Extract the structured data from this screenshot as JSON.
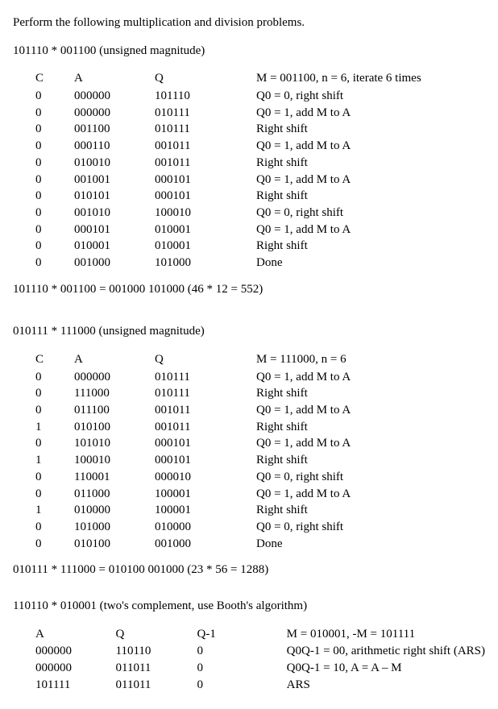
{
  "intro": "Perform the following multiplication and division problems.",
  "p1": {
    "title": "101110 * 001100 (unsigned magnitude)",
    "headers": {
      "c": "C",
      "a": "A",
      "q": "Q",
      "cmt": "M = 001100, n = 6, iterate 6 times"
    },
    "rows": [
      {
        "c": "0",
        "a": "000000",
        "q": "101110",
        "cmt": "Q0 = 0, right shift"
      },
      {
        "c": "0",
        "a": "000000",
        "q": "010111",
        "cmt": "Q0 = 1, add M to A"
      },
      {
        "c": "0",
        "a": "001100",
        "q": "010111",
        "cmt": "Right shift"
      },
      {
        "c": "0",
        "a": "000110",
        "q": "001011",
        "cmt": "Q0 = 1, add M to A"
      },
      {
        "c": "0",
        "a": "010010",
        "q": "001011",
        "cmt": "Right shift"
      },
      {
        "c": "0",
        "a": "001001",
        "q": "000101",
        "cmt": "Q0 = 1, add M to A"
      },
      {
        "c": "0",
        "a": "010101",
        "q": "000101",
        "cmt": "Right shift"
      },
      {
        "c": "0",
        "a": "001010",
        "q": "100010",
        "cmt": "Q0 = 0, right shift"
      },
      {
        "c": "0",
        "a": "000101",
        "q": "010001",
        "cmt": "Q0 = 1, add M to A"
      },
      {
        "c": "0",
        "a": "010001",
        "q": "010001",
        "cmt": "Right shift"
      },
      {
        "c": "0",
        "a": "001000",
        "q": "101000",
        "cmt": "Done"
      }
    ],
    "result": "101110 * 001100 = 001000 101000 (46 * 12 = 552)"
  },
  "p2": {
    "title": "010111 * 111000 (unsigned magnitude)",
    "headers": {
      "c": "C",
      "a": "A",
      "q": "Q",
      "cmt": "M = 111000, n = 6"
    },
    "rows": [
      {
        "c": "0",
        "a": "000000",
        "q": "010111",
        "cmt": "Q0 = 1, add M to A"
      },
      {
        "c": "0",
        "a": "111000",
        "q": "010111",
        "cmt": "Right shift"
      },
      {
        "c": "0",
        "a": "011100",
        "q": "001011",
        "cmt": "Q0 = 1, add M to A"
      },
      {
        "c": "1",
        "a": "010100",
        "q": "001011",
        "cmt": "Right shift"
      },
      {
        "c": "0",
        "a": "101010",
        "q": "000101",
        "cmt": "Q0 = 1, add M to A"
      },
      {
        "c": "1",
        "a": "100010",
        "q": "000101",
        "cmt": "Right shift"
      },
      {
        "c": "0",
        "a": "110001",
        "q": "000010",
        "cmt": "Q0 = 0, right shift"
      },
      {
        "c": "0",
        "a": "011000",
        "q": "100001",
        "cmt": "Q0 = 1, add M to A"
      },
      {
        "c": "1",
        "a": "010000",
        "q": "100001",
        "cmt": "Right shift"
      },
      {
        "c": "0",
        "a": "101000",
        "q": "010000",
        "cmt": "Q0 = 0, right shift"
      },
      {
        "c": "0",
        "a": "010100",
        "q": "001000",
        "cmt": "Done"
      }
    ],
    "result": "010111 * 111000 = 010100 001000 (23 * 56 = 1288)"
  },
  "p3": {
    "title": "110110 * 010001 (two's complement, use Booth's algorithm)",
    "headers": {
      "a": "A",
      "q": "Q",
      "q1": "Q-1",
      "cmt": "M = 010001, -M = 101111"
    },
    "rows": [
      {
        "a": "000000",
        "q": "110110",
        "q1": "0",
        "cmt": "Q0Q-1 = 00, arithmetic right shift (ARS)"
      },
      {
        "a": "000000",
        "q": "011011",
        "q1": "0",
        "cmt": "Q0Q-1 = 10, A = A – M"
      },
      {
        "a": "101111",
        "q": "011011",
        "q1": "0",
        "cmt": "ARS"
      }
    ]
  }
}
